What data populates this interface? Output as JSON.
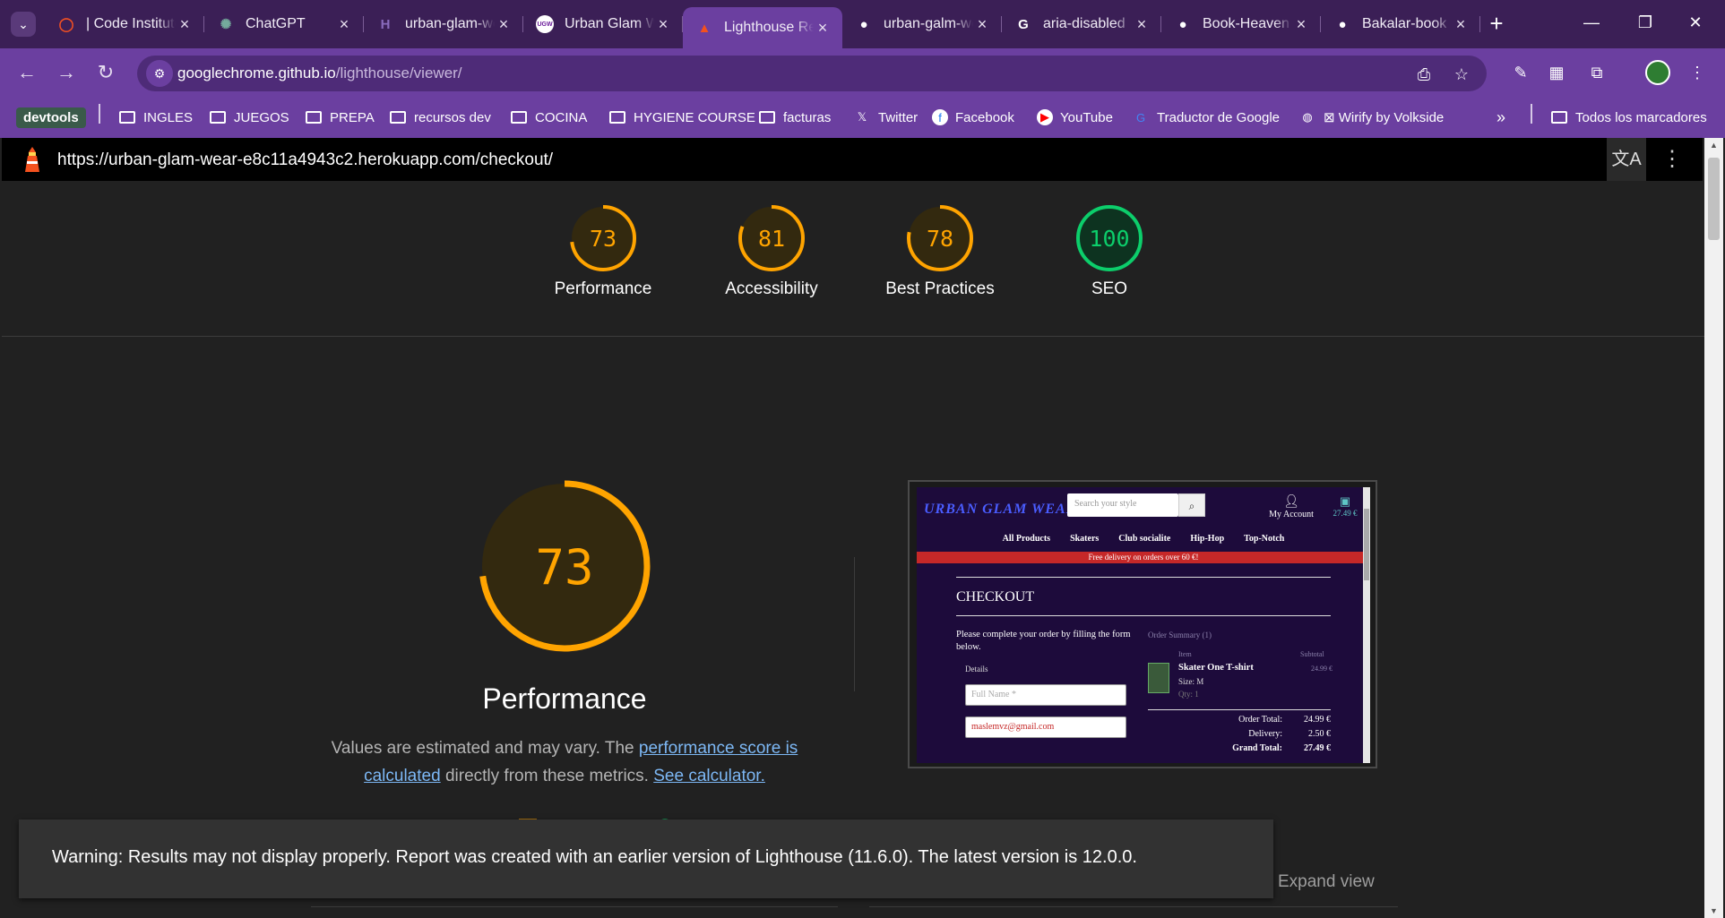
{
  "browser": {
    "tabs": [
      {
        "title": "| Code Institute",
        "icon": "code-institute-icon",
        "color": "#f25022",
        "glyph": "◯"
      },
      {
        "title": "ChatGPT",
        "icon": "chatgpt-icon",
        "color": "#74aa9c",
        "glyph": "✺"
      },
      {
        "title": "urban-glam-wear",
        "icon": "heroku-icon",
        "color": "#8a6bbd",
        "glyph": "H"
      },
      {
        "title": "Urban Glam Wear",
        "icon": "ugw-icon",
        "color": "#6a1b9a",
        "glyph": "UGW"
      },
      {
        "title": "Lighthouse Report Viewer",
        "icon": "lighthouse-icon",
        "color": "#f4511e",
        "glyph": "▲",
        "active": true
      },
      {
        "title": "urban-galm-wear",
        "icon": "github-icon",
        "color": "#ffffff",
        "glyph": "●"
      },
      {
        "title": "aria-disabled",
        "icon": "google-icon",
        "color": "#ffffff",
        "glyph": "G"
      },
      {
        "title": "Book-Heaven",
        "icon": "github-icon",
        "color": "#ffffff",
        "glyph": "●"
      },
      {
        "title": "Bakalar-book",
        "icon": "github-icon",
        "color": "#ffffff",
        "glyph": "●"
      }
    ],
    "url_host": "googlechrome.github.io",
    "url_path": "/lighthouse/viewer/",
    "bookmarks": [
      {
        "label": "devtools",
        "type": "pill"
      },
      {
        "label": "INGLES",
        "type": "folder"
      },
      {
        "label": "JUEGOS",
        "type": "folder"
      },
      {
        "label": "PREPA",
        "type": "folder"
      },
      {
        "label": "recursos dev",
        "type": "folder"
      },
      {
        "label": "COCINA",
        "type": "folder"
      },
      {
        "label": "HYGIENE COURSE",
        "type": "folder"
      },
      {
        "label": "facturas",
        "type": "folder"
      },
      {
        "label": "Twitter",
        "type": "x-icon"
      },
      {
        "label": "Facebook",
        "type": "facebook-icon"
      },
      {
        "label": "YouTube",
        "type": "youtube-icon"
      },
      {
        "label": "Traductor de Google",
        "type": "translate-icon"
      },
      {
        "label": "⊠ Wirify by Volkside",
        "type": "globe-icon"
      }
    ],
    "all_bookmarks": "Todos los marcadores"
  },
  "lighthouse": {
    "report_url": "https://urban-glam-wear-e8c11a4943c2.herokuapp.com/checkout/",
    "scores": [
      {
        "label": "Performance",
        "value": 73,
        "color": "#ffa400",
        "bg": "#33290f"
      },
      {
        "label": "Accessibility",
        "value": 81,
        "color": "#ffa400",
        "bg": "#33290f"
      },
      {
        "label": "Best Practices",
        "value": 78,
        "color": "#ffa400",
        "bg": "#33290f"
      },
      {
        "label": "SEO",
        "value": 100,
        "color": "#0cce6b",
        "bg": "#0d3320"
      }
    ],
    "perf_title": "Performance",
    "perf_score": 73,
    "desc_prefix": "Values are estimated and may vary. The ",
    "desc_link1": "performance score is calculated",
    "desc_mid": " directly from these metrics. ",
    "desc_link2": "See calculator.",
    "expand": "Expand view",
    "warning": "Warning: Results may not display properly. Report was created with an earlier version of Lighthouse (11.6.0). The latest version is 12.0.0."
  },
  "screenshot": {
    "logo": "URBAN GLAM WEAR",
    "search_placeholder": "Search your style",
    "account": "My Account",
    "bag_total": "27.49 €",
    "nav": [
      "All Products",
      "Skaters",
      "Club socialite",
      "Hip-Hop",
      "Top-Notch"
    ],
    "banner": "Free delivery on orders over 60 €!",
    "heading": "CHECKOUT",
    "instructions": "Please complete your order by filling the form below.",
    "details": "Details",
    "fullname_placeholder": "Full Name *",
    "email_value": "maslemvz@gmail.com",
    "order_summary": "Order Summary (1)",
    "col_item": "Item",
    "col_subtotal": "Subtotal",
    "product": "Skater One T-shirt",
    "size": "Size: M",
    "qty": "Qty: 1",
    "price": "24.99 €",
    "order_total_label": "Order Total:",
    "order_total": "24.99 €",
    "delivery_label": "Delivery:",
    "delivery": "2.50 €",
    "grand_total_label": "Grand Total:",
    "grand_total": "27.49 €"
  }
}
